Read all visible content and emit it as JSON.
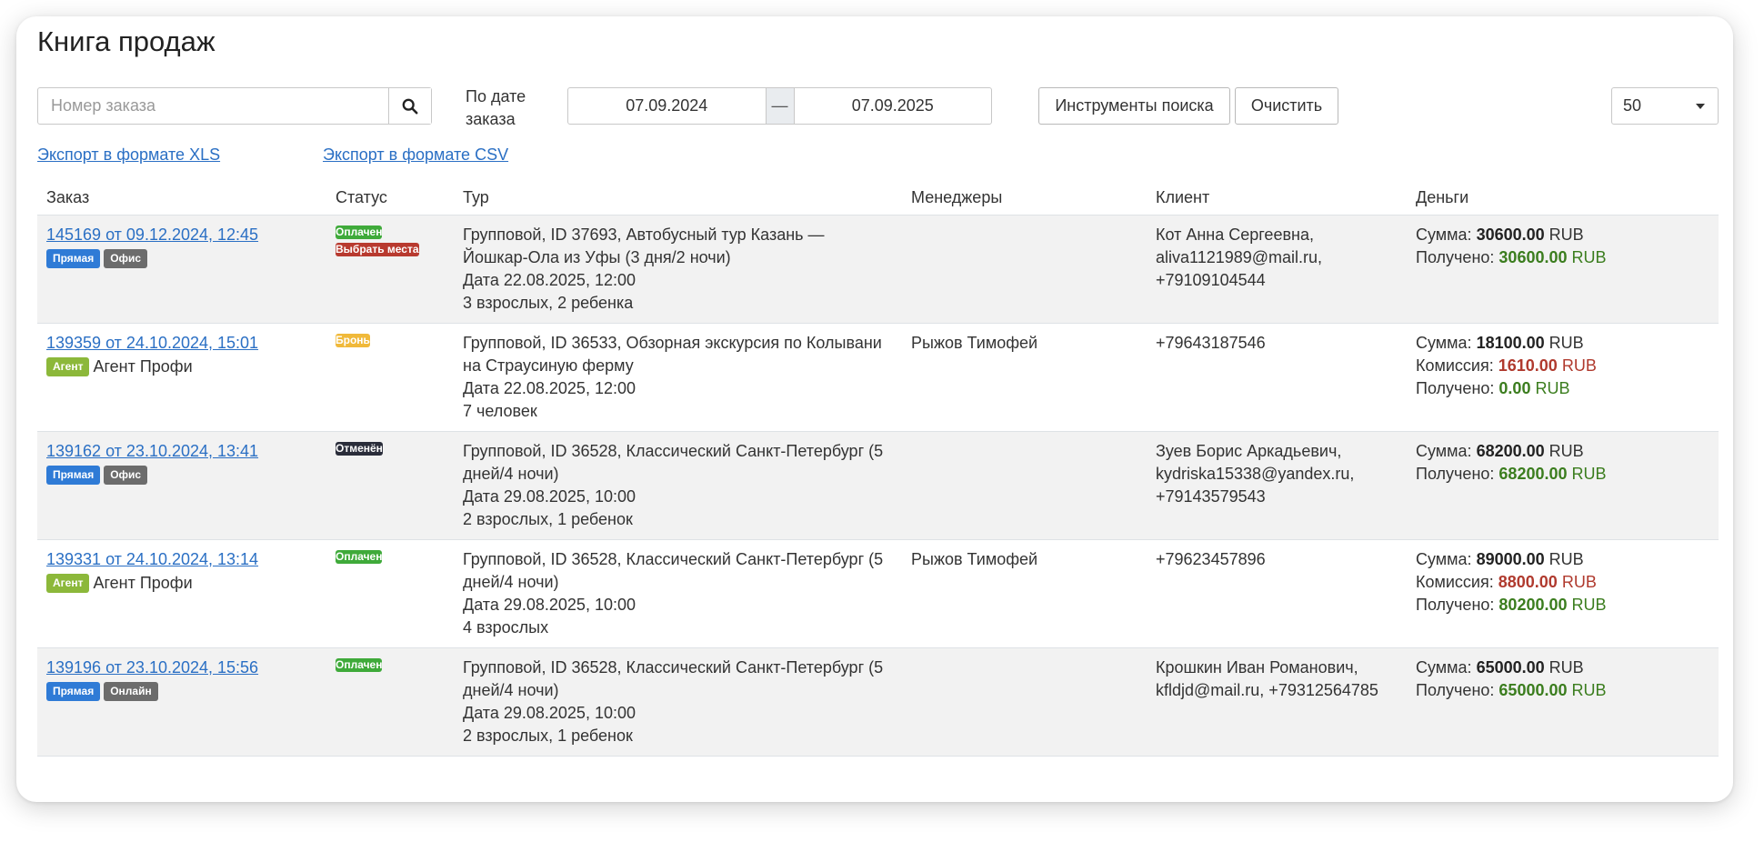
{
  "page": {
    "title": "Книга продаж"
  },
  "search": {
    "placeholder": "Номер заказа"
  },
  "date_filter": {
    "label": "По дате заказа",
    "from": "07.09.2024",
    "separator": "—",
    "to": "07.09.2025"
  },
  "buttons": {
    "search_tools": "Инструменты поиска",
    "clear": "Очистить"
  },
  "page_size": {
    "value": "50"
  },
  "export": {
    "xls": "Экспорт в формате XLS",
    "csv": "Экспорт в формате CSV"
  },
  "table": {
    "headers": {
      "order": "Заказ",
      "status": "Статус",
      "tour": "Тур",
      "managers": "Менеджеры",
      "client": "Клиент",
      "money": "Деньги"
    },
    "money_labels": {
      "sum": "Сумма:",
      "commission": "Комиссия:",
      "received": "Получено:",
      "currency": "RUB"
    },
    "rows": [
      {
        "order": "145169 от 09.12.2024, 12:45",
        "tags": [
          "Прямая",
          "Офис"
        ],
        "statuses": [
          "Оплачен",
          "Выбрать места"
        ],
        "tour": "Групповой, ID 37693, Автобусный тур Казань — Йошкар-Ола из Уфы (3 дня/2 ночи)",
        "date": "Дата 22.08.2025, 12:00",
        "people": "3 взрослых, 2 ребенка",
        "manager": "",
        "client": "Кот Анна Сергеевна, aliva1121989@mail.ru, +79109104544",
        "sum": "30600.00",
        "received": "30600.00"
      },
      {
        "order": "139359 от 24.10.2024, 15:01",
        "agent": {
          "tag": "Агент",
          "name": "Агент Профи"
        },
        "statuses": [
          "Бронь"
        ],
        "tour": "Групповой, ID 36533, Обзорная экскурсия по Колывани на Страусиную ферму",
        "date": "Дата 22.08.2025, 12:00",
        "people": "7 человек",
        "manager": "Рыжов Тимофей",
        "client": "+79643187546",
        "sum": "18100.00",
        "commission": "1610.00",
        "received": "0.00"
      },
      {
        "order": "139162 от 23.10.2024, 13:41",
        "tags": [
          "Прямая",
          "Офис"
        ],
        "statuses": [
          "Отменён"
        ],
        "tour": "Групповой, ID 36528, Классический Санкт-Петербург (5 дней/4 ночи)",
        "date": "Дата 29.08.2025, 10:00",
        "people": "2 взрослых, 1 ребенок",
        "manager": "",
        "client": "Зуев Борис Аркадьевич, kydriska15338@yandex.ru, +79143579543",
        "sum": "68200.00",
        "received": "68200.00"
      },
      {
        "order": "139331 от 24.10.2024, 13:14",
        "agent": {
          "tag": "Агент",
          "name": "Агент Профи"
        },
        "statuses": [
          "Оплачен"
        ],
        "tour": "Групповой, ID 36528, Классический Санкт-Петербург (5 дней/4 ночи)",
        "date": "Дата 29.08.2025, 10:00",
        "people": "4 взрослых",
        "manager": "Рыжов Тимофей",
        "client": "+79623457896",
        "sum": "89000.00",
        "commission": "8800.00",
        "received": "80200.00"
      },
      {
        "order": "139196 от 23.10.2024, 15:56",
        "tags": [
          "Прямая",
          "Онлайн"
        ],
        "statuses": [
          "Оплачен"
        ],
        "tour": "Групповой, ID 36528, Классический Санкт-Петербург (5 дней/4 ночи)",
        "date": "Дата 29.08.2025, 10:00",
        "people": "2 взрослых, 1 ребенок",
        "manager": "",
        "client": "Крошкин Иван Романович, kfldjd@mail.ru, +79312564785",
        "sum": "65000.00",
        "received": "65000.00"
      }
    ]
  }
}
